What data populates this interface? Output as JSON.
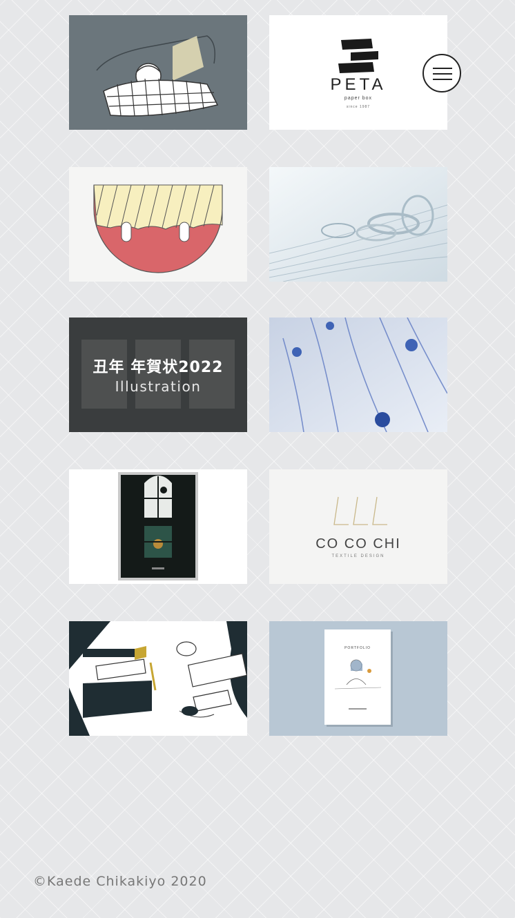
{
  "brand": {
    "peta_name": "PETA",
    "peta_sub": "paper box",
    "peta_since": "since 1987",
    "cocochi_name": "CO CO CHI",
    "cocochi_sub": "TEXTILE DESIGN",
    "portfolio_title": "PORTFOLIO"
  },
  "works": [
    {
      "id": "sleeping-illustration"
    },
    {
      "id": "peta-logo"
    },
    {
      "id": "cup-illustration"
    },
    {
      "id": "glass-photo"
    },
    {
      "id": "nengajo-2022",
      "overlay_title": "丑年 年賀状2022",
      "overlay_subtitle": "Illustration"
    },
    {
      "id": "textile-photo"
    },
    {
      "id": "window-poster"
    },
    {
      "id": "cocochi-logo"
    },
    {
      "id": "objects-illustration"
    },
    {
      "id": "portfolio-book"
    }
  ],
  "menu": {
    "icon": "hamburger-icon"
  },
  "footer": {
    "copyright": "©Kaede Chikakiyo 2020"
  },
  "colors": {
    "background": "#e6e7e9",
    "slate": "#6b767c",
    "red": "#d9666a",
    "cream": "#f7efbf",
    "navy": "#1f2d33",
    "bluegray": "#b8c7d4"
  }
}
